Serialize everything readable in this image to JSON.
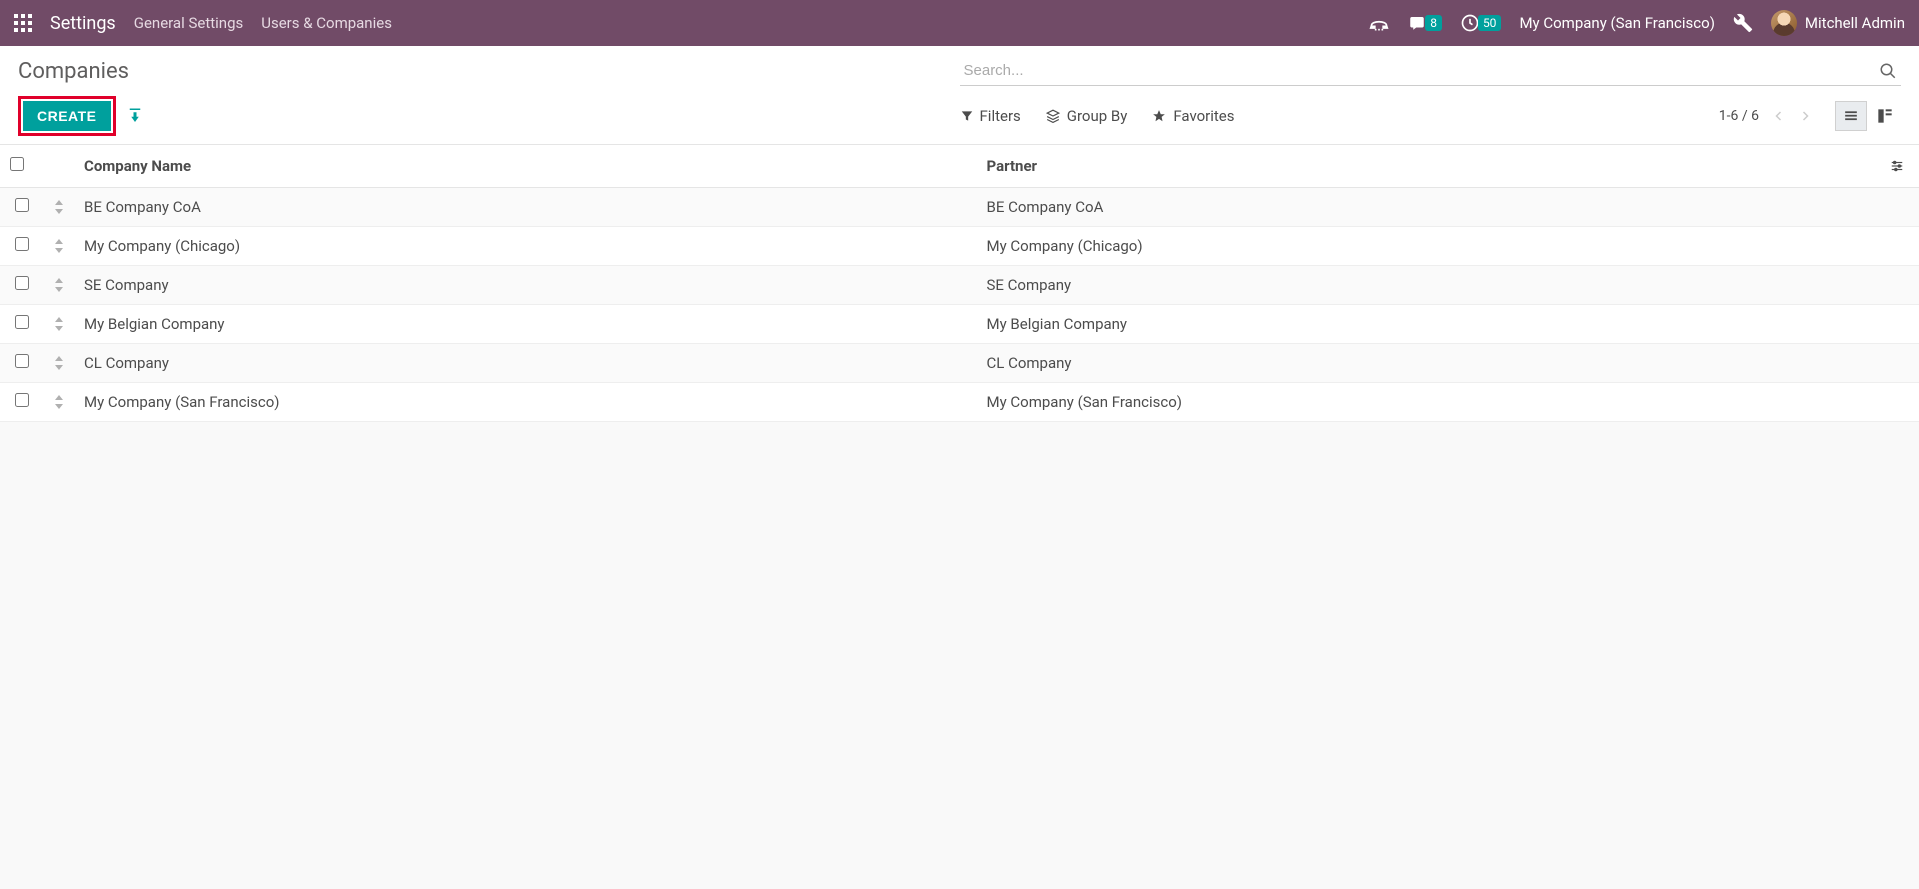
{
  "navbar": {
    "brand": "Settings",
    "menu": [
      "General Settings",
      "Users & Companies"
    ],
    "messages_badge": "8",
    "activities_badge": "50",
    "company": "My Company (San Francisco)",
    "user": "Mitchell Admin"
  },
  "control": {
    "title": "Companies",
    "create_label": "CREATE",
    "search_placeholder": "Search...",
    "filters_label": "Filters",
    "groupby_label": "Group By",
    "favorites_label": "Favorites",
    "pager": "1-6 / 6"
  },
  "table": {
    "columns": {
      "name": "Company Name",
      "partner": "Partner"
    },
    "rows": [
      {
        "name": "BE Company CoA",
        "partner": "BE Company CoA"
      },
      {
        "name": "My Company (Chicago)",
        "partner": "My Company (Chicago)"
      },
      {
        "name": "SE Company",
        "partner": "SE Company"
      },
      {
        "name": "My Belgian Company",
        "partner": "My Belgian Company"
      },
      {
        "name": "CL Company",
        "partner": "CL Company"
      },
      {
        "name": "My Company (San Francisco)",
        "partner": "My Company (San Francisco)"
      }
    ]
  }
}
